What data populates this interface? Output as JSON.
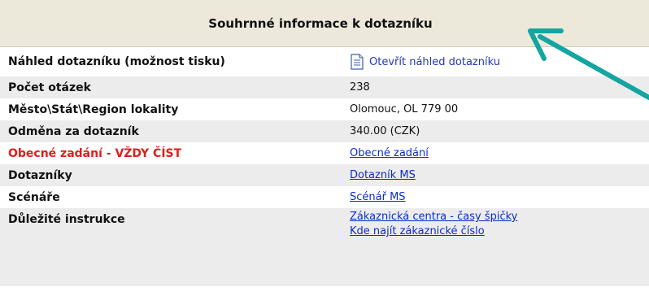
{
  "panel": {
    "title": "Souhrnné informace k dotazníku"
  },
  "rows": [
    {
      "label": "Náhled dotazníku (možnost tisku)",
      "value": "Otevřít náhled dotazníku",
      "icon": "document-icon"
    },
    {
      "label": "Počet otázek",
      "value": "238"
    },
    {
      "label": "Město\\Stát\\Region lokality",
      "value": "Olomouc, OL 779 00"
    },
    {
      "label": "Odměna za dotazník",
      "value": "340.00 (CZK)"
    },
    {
      "label": "Obecné zadání - VŽDY ČÍST",
      "value": "Obecné zadání",
      "color": "#e21c1c"
    },
    {
      "label": "Dotazníky",
      "value": "Dotazník MS"
    },
    {
      "label": "Scénáře",
      "value": "Scénář MS"
    },
    {
      "label": "Důležité instrukce",
      "values": [
        "Zákaznická centra - časy špičky",
        "Kde najít zákaznické číslo"
      ]
    }
  ],
  "colors": {
    "header_bg": "#ece9da",
    "row_shade": "#ececec",
    "link": "#0b2ccc",
    "alert": "#e21c1c",
    "annotation_arrow": "#13a5a1"
  },
  "annotation": {
    "icon": "teal-arrow-pointing-to-header"
  }
}
